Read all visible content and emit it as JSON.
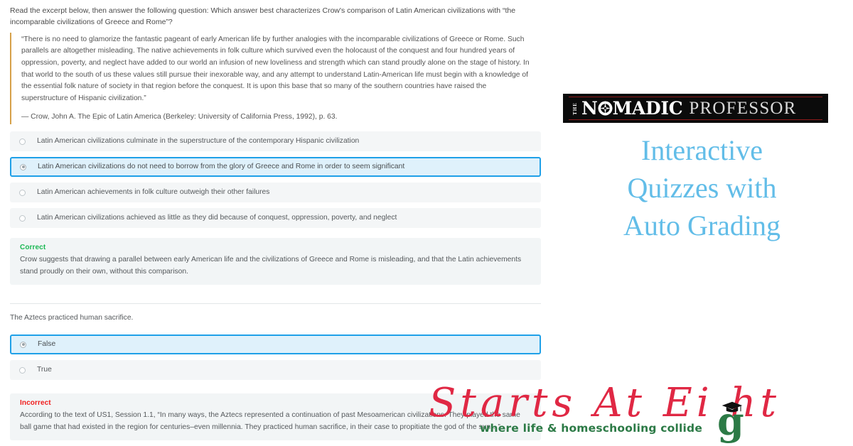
{
  "quiz": {
    "prompt": "Read the excerpt below, then answer the following question: Which answer best characterizes Crow's comparison of Latin American civilizations with “the incomparable civilizations of Greece and Rome”?",
    "excerpt": {
      "body": "“There is no need to glamorize the fantastic pageant of early American life by further analogies with the incomparable civilizations of Greece or Rome. Such parallels are altogether misleading. The native achievements in folk culture which survived even the holocaust of the conquest and four hundred years of oppression, poverty, and neglect have added to our world an infusion of new loveliness and strength which can stand proudly alone on the stage of history. In that world to the south of us these values still pursue their inexorable way, and any attempt to understand Latin-American life must begin with a knowledge of the essential folk nature of society in that region before the conquest. It is upon this base that so many of the southern countries have raised the superstructure of Hispanic civilization.”",
      "citation": "— Crow, John A. The Epic of Latin America (Berkeley: University of California Press, 1992), p. 63."
    },
    "question1": {
      "options": [
        {
          "label": "Latin American civilizations culminate in the superstructure of the contemporary Hispanic civilization",
          "selected": false
        },
        {
          "label": "Latin American civilizations do not need to borrow from the glory of Greece and Rome in order to seem significant",
          "selected": true
        },
        {
          "label": "Latin American achievements in folk culture outweigh their other failures",
          "selected": false
        },
        {
          "label": "Latin American civilizations achieved as little as they did because of conquest, oppression, poverty, and neglect",
          "selected": false
        }
      ],
      "feedback": {
        "status": "Correct",
        "status_color": "#1cb854",
        "body": "Crow suggests that drawing a parallel between early American life and the civilizations of Greece and Rome is misleading, and that the Latin achievements stand proudly on their own, without this comparison."
      }
    },
    "question2": {
      "text": "The Aztecs practiced human sacrifice.",
      "options": [
        {
          "label": "False",
          "selected": true
        },
        {
          "label": "True",
          "selected": false
        }
      ],
      "feedback": {
        "status": "Incorrect",
        "status_color": "#f01d1d",
        "body": "According to the text of US1, Session 1.1, “In many ways, the Aztecs represented a continuation of past Mesoamerican civilizations. They played the same ball game that had existed in the region for centuries–even millennia. They practiced human sacrifice, in their case to propitiate the god of the sun…”"
      }
    },
    "colors": {
      "selected_background": "#dff1fb",
      "selected_border": "#1fa0e8",
      "option_background": "#f4f6f7",
      "feedback_background": "#f2f5f6",
      "excerpt_rule": "#d6a14a"
    }
  },
  "promo": {
    "logo": {
      "the": "THE",
      "nomadic_part1": "N",
      "nomadic_part2": "MADIC",
      "professor": "PROFESSOR",
      "compass_icon": "compass-rose-icon",
      "background": "#0b0b0b",
      "rule_color": "#8c1a1a"
    },
    "heading_line1": "Interactive",
    "heading_line2": "Quizzes with",
    "heading_line3": "Auto Grading",
    "heading_color": "#62bde8"
  },
  "watermark": {
    "script_text": "Starts At Ei ht",
    "g_letter": "g",
    "tagline": "where life & homeschooling collide",
    "script_color": "#e02844",
    "tagline_color": "#2c7a46",
    "cap_icon": "graduation-cap-icon"
  }
}
